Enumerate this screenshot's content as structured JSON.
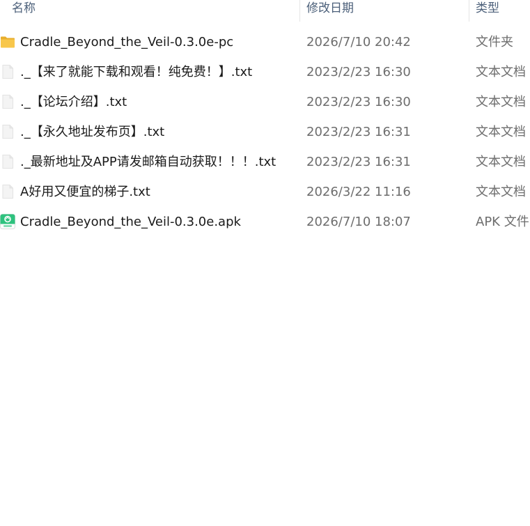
{
  "columns": {
    "name": "名称",
    "date_modified": "修改日期",
    "type": "类型"
  },
  "colors": {
    "header_text": "#4c607a",
    "name_text": "#1a1a1a",
    "meta_text": "#6d6d6d",
    "folder": "#f8c74b",
    "apk": "#2ec27e"
  },
  "files": [
    {
      "name": "Cradle_Beyond_the_Veil-0.3.0e-pc",
      "date": "2026/7/10 20:42",
      "type": "文件夹",
      "icon": "folder-icon"
    },
    {
      "name": "._【来了就能下载和观看！纯免费！】.txt",
      "date": "2023/2/23 16:30",
      "type": "文本文档",
      "icon": "text-file-icon"
    },
    {
      "name": "._【论坛介绍】.txt",
      "date": "2023/2/23 16:30",
      "type": "文本文档",
      "icon": "text-file-icon"
    },
    {
      "name": "._【永久地址发布页】.txt",
      "date": "2023/2/23 16:31",
      "type": "文本文档",
      "icon": "text-file-icon"
    },
    {
      "name": "._最新地址及APP请发邮箱自动获取！！！.txt",
      "date": "2023/2/23 16:31",
      "type": "文本文档",
      "icon": "text-file-icon"
    },
    {
      "name": "A好用又便宜的梯子.txt",
      "date": "2026/3/22 11:16",
      "type": "文本文档",
      "icon": "text-file-icon"
    },
    {
      "name": "Cradle_Beyond_the_Veil-0.3.0e.apk",
      "date": "2026/7/10 18:07",
      "type": "APK 文件",
      "icon": "apk-file-icon"
    }
  ]
}
